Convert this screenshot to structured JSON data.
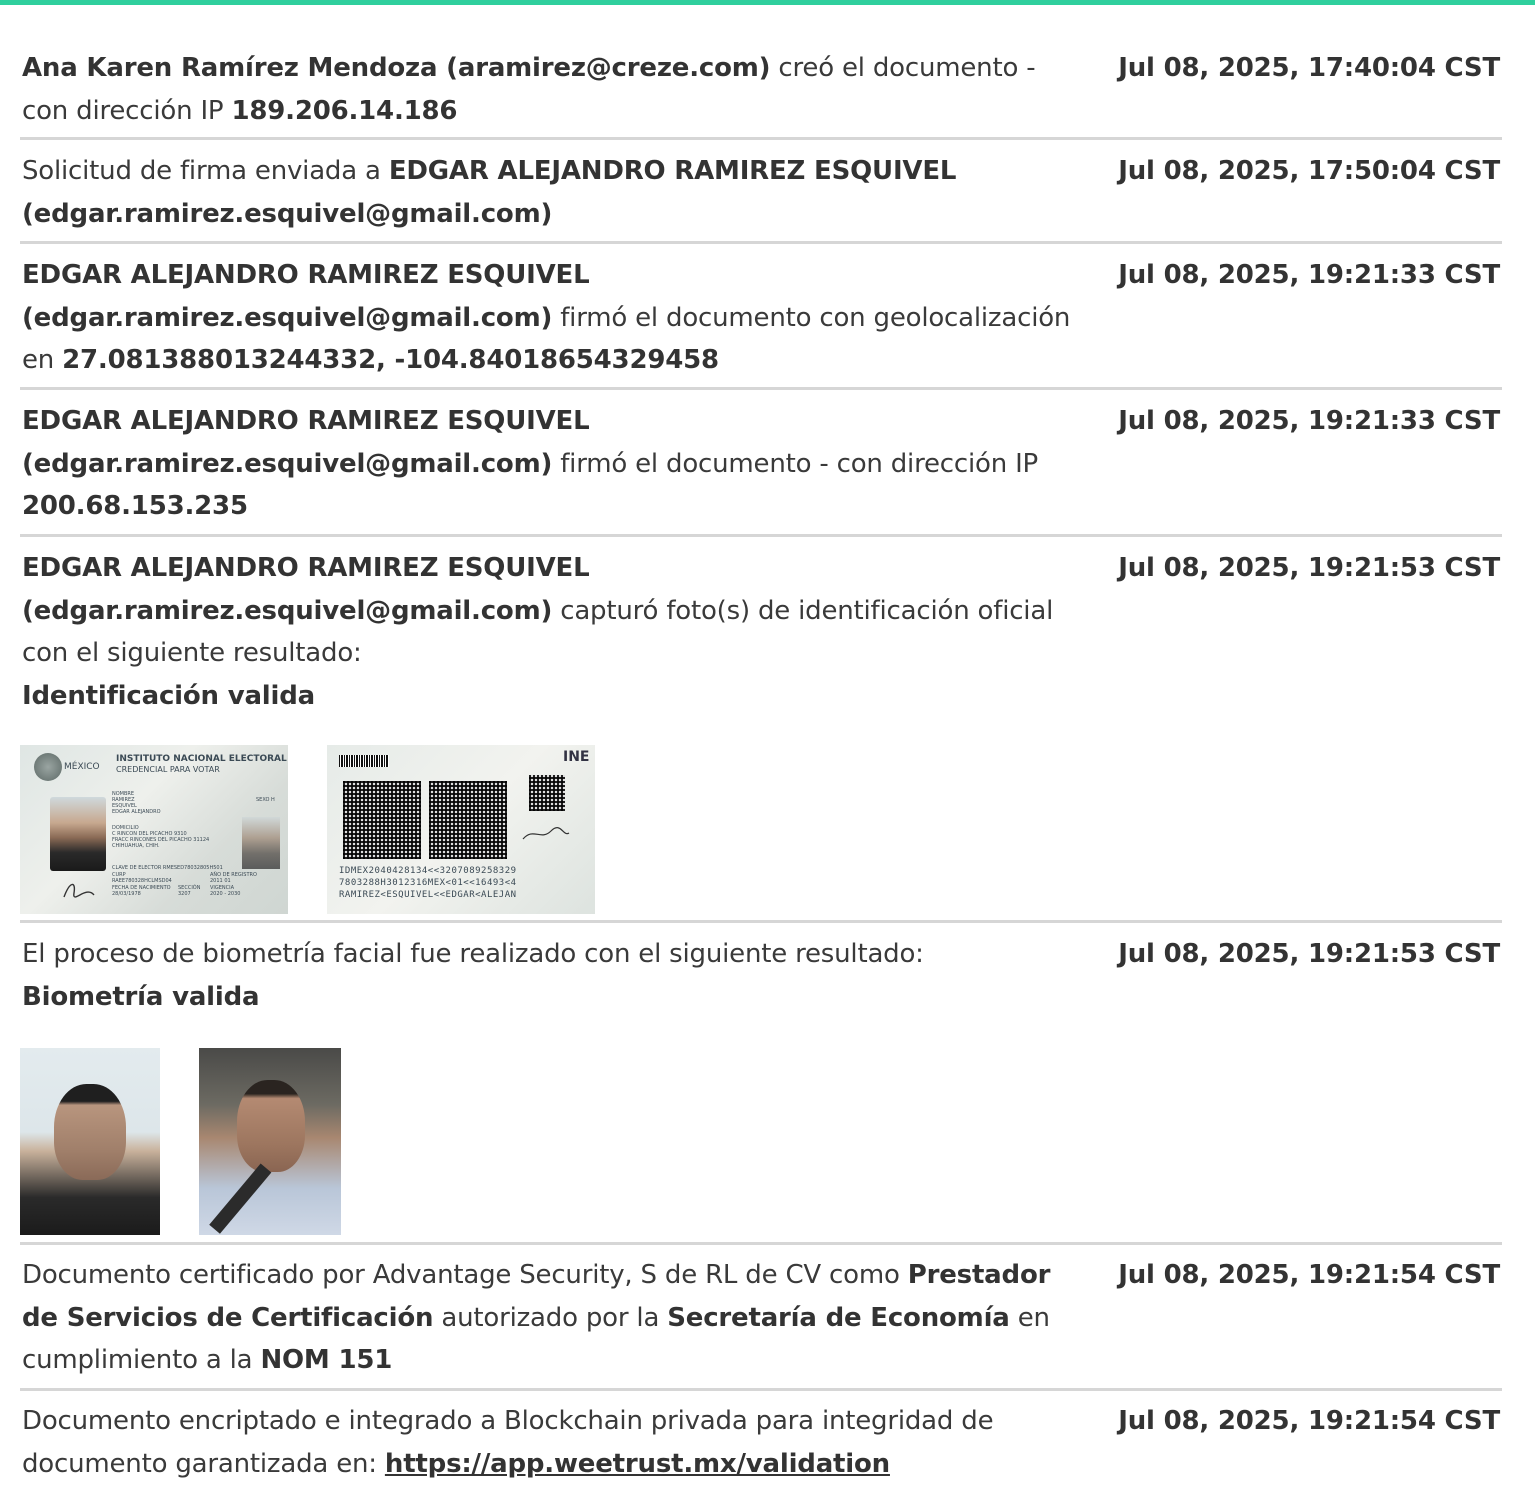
{
  "entries": [
    {
      "parts": [
        {
          "b": true,
          "t": "Ana Karen Ramírez Mendoza (aramirez@creze.com)"
        },
        {
          "b": false,
          "t": " creó el documento - con dirección IP "
        },
        {
          "b": true,
          "t": "189.206.14.186"
        }
      ],
      "date": "Jul 08, 2025, 17:40:04 CST"
    },
    {
      "parts": [
        {
          "b": false,
          "t": "Solicitud de firma enviada a "
        },
        {
          "b": true,
          "t": "EDGAR ALEJANDRO RAMIREZ ESQUIVEL (edgar.ramirez.esquivel@gmail.com)"
        }
      ],
      "date": "Jul 08, 2025, 17:50:04 CST"
    },
    {
      "parts": [
        {
          "b": true,
          "t": "EDGAR ALEJANDRO RAMIREZ ESQUIVEL"
        },
        {
          "br": true
        },
        {
          "b": true,
          "t": "(edgar.ramirez.esquivel@gmail.com)"
        },
        {
          "b": false,
          "t": " firmó el documento con geolocalización en "
        },
        {
          "b": true,
          "t": "27.081388013244332, -104.84018654329458"
        }
      ],
      "date": "Jul 08, 2025, 19:21:33 CST"
    },
    {
      "parts": [
        {
          "b": true,
          "t": "EDGAR ALEJANDRO RAMIREZ ESQUIVEL"
        },
        {
          "br": true
        },
        {
          "b": true,
          "t": "(edgar.ramirez.esquivel@gmail.com)"
        },
        {
          "b": false,
          "t": " firmó el documento - con dirección IP "
        },
        {
          "b": true,
          "t": "200.68.153.235"
        }
      ],
      "date": "Jul 08, 2025, 19:21:33 CST"
    },
    {
      "parts": [
        {
          "b": true,
          "t": "EDGAR ALEJANDRO RAMIREZ ESQUIVEL"
        },
        {
          "br": true
        },
        {
          "b": true,
          "t": "(edgar.ramirez.esquivel@gmail.com)"
        },
        {
          "b": false,
          "t": " capturó foto(s) de identificación oficial con el siguiente resultado:"
        },
        {
          "br": true
        },
        {
          "b": true,
          "t": "Identificación valida"
        }
      ],
      "date": "Jul 08, 2025, 19:21:53 CST"
    },
    {
      "parts": [
        {
          "b": false,
          "t": "El proceso de biometría facial fue realizado con el siguiente resultado:"
        },
        {
          "br": true
        },
        {
          "b": true,
          "t": "Biometría valida"
        }
      ],
      "date": "Jul 08, 2025, 19:21:53 CST"
    },
    {
      "parts": [
        {
          "b": false,
          "t": "Documento certificado por Advantage Security, S de RL de CV como "
        },
        {
          "b": true,
          "t": "Prestador de Servicios de Certificación"
        },
        {
          "b": false,
          "t": " autorizado por la "
        },
        {
          "b": true,
          "t": "Secretaría de Economía"
        },
        {
          "b": false,
          "t": " en cumplimiento a la "
        },
        {
          "b": true,
          "t": "NOM 151"
        }
      ],
      "date": "Jul 08, 2025, 19:21:54 CST"
    },
    {
      "parts": [
        {
          "b": false,
          "t": "Documento encriptado e integrado a Blockchain privada para integridad de documento garantizada en: "
        },
        {
          "link": true,
          "t": "https://app.weetrust.mx/validation"
        }
      ],
      "date": "Jul 08, 2025, 19:21:54 CST"
    }
  ],
  "id_card": {
    "country": "MÉXICO",
    "institute": "INSTITUTO NACIONAL ELECTORAL",
    "credential": "CREDENCIAL PARA VOTAR",
    "name_label": "NOMBRE",
    "name_lines": [
      "RAMIREZ",
      "ESQUIVEL",
      "EDGAR ALEJANDRO"
    ],
    "sex_label": "SEXO H",
    "address_label": "DOMICILIO",
    "address_lines": [
      "C RINCON DEL PICACHO 9310",
      "FRACC RINCONES DEL PICACHO 31124",
      "CHIHUAHUA, CHIH."
    ],
    "elector_key": "CLAVE DE ELECTOR  RMESED78032805H501",
    "curp_label": "CURP",
    "registration_label": "AÑO DE REGISTRO",
    "curp": "RAEE780328HCLMSD04",
    "registration_year": "2011 01",
    "birth_label": "FECHA DE NACIMIENTO",
    "section_label": "SECCIÓN",
    "validity_label": "VIGENCIA",
    "birth_date": "28/03/1978",
    "section": "3207",
    "validity": "2020 - 2030",
    "back_brand": "INE",
    "mrz": [
      "IDMEX2040428134<<3207089258329",
      "7803288H3012316MEX<01<<16493<4",
      "RAMIREZ<ESQUIVEL<<EDGAR<ALEJAN"
    ]
  },
  "colors": {
    "accent": "#2fcf9d",
    "rule": "#d6d6d6",
    "text": "#3a3a3a"
  }
}
